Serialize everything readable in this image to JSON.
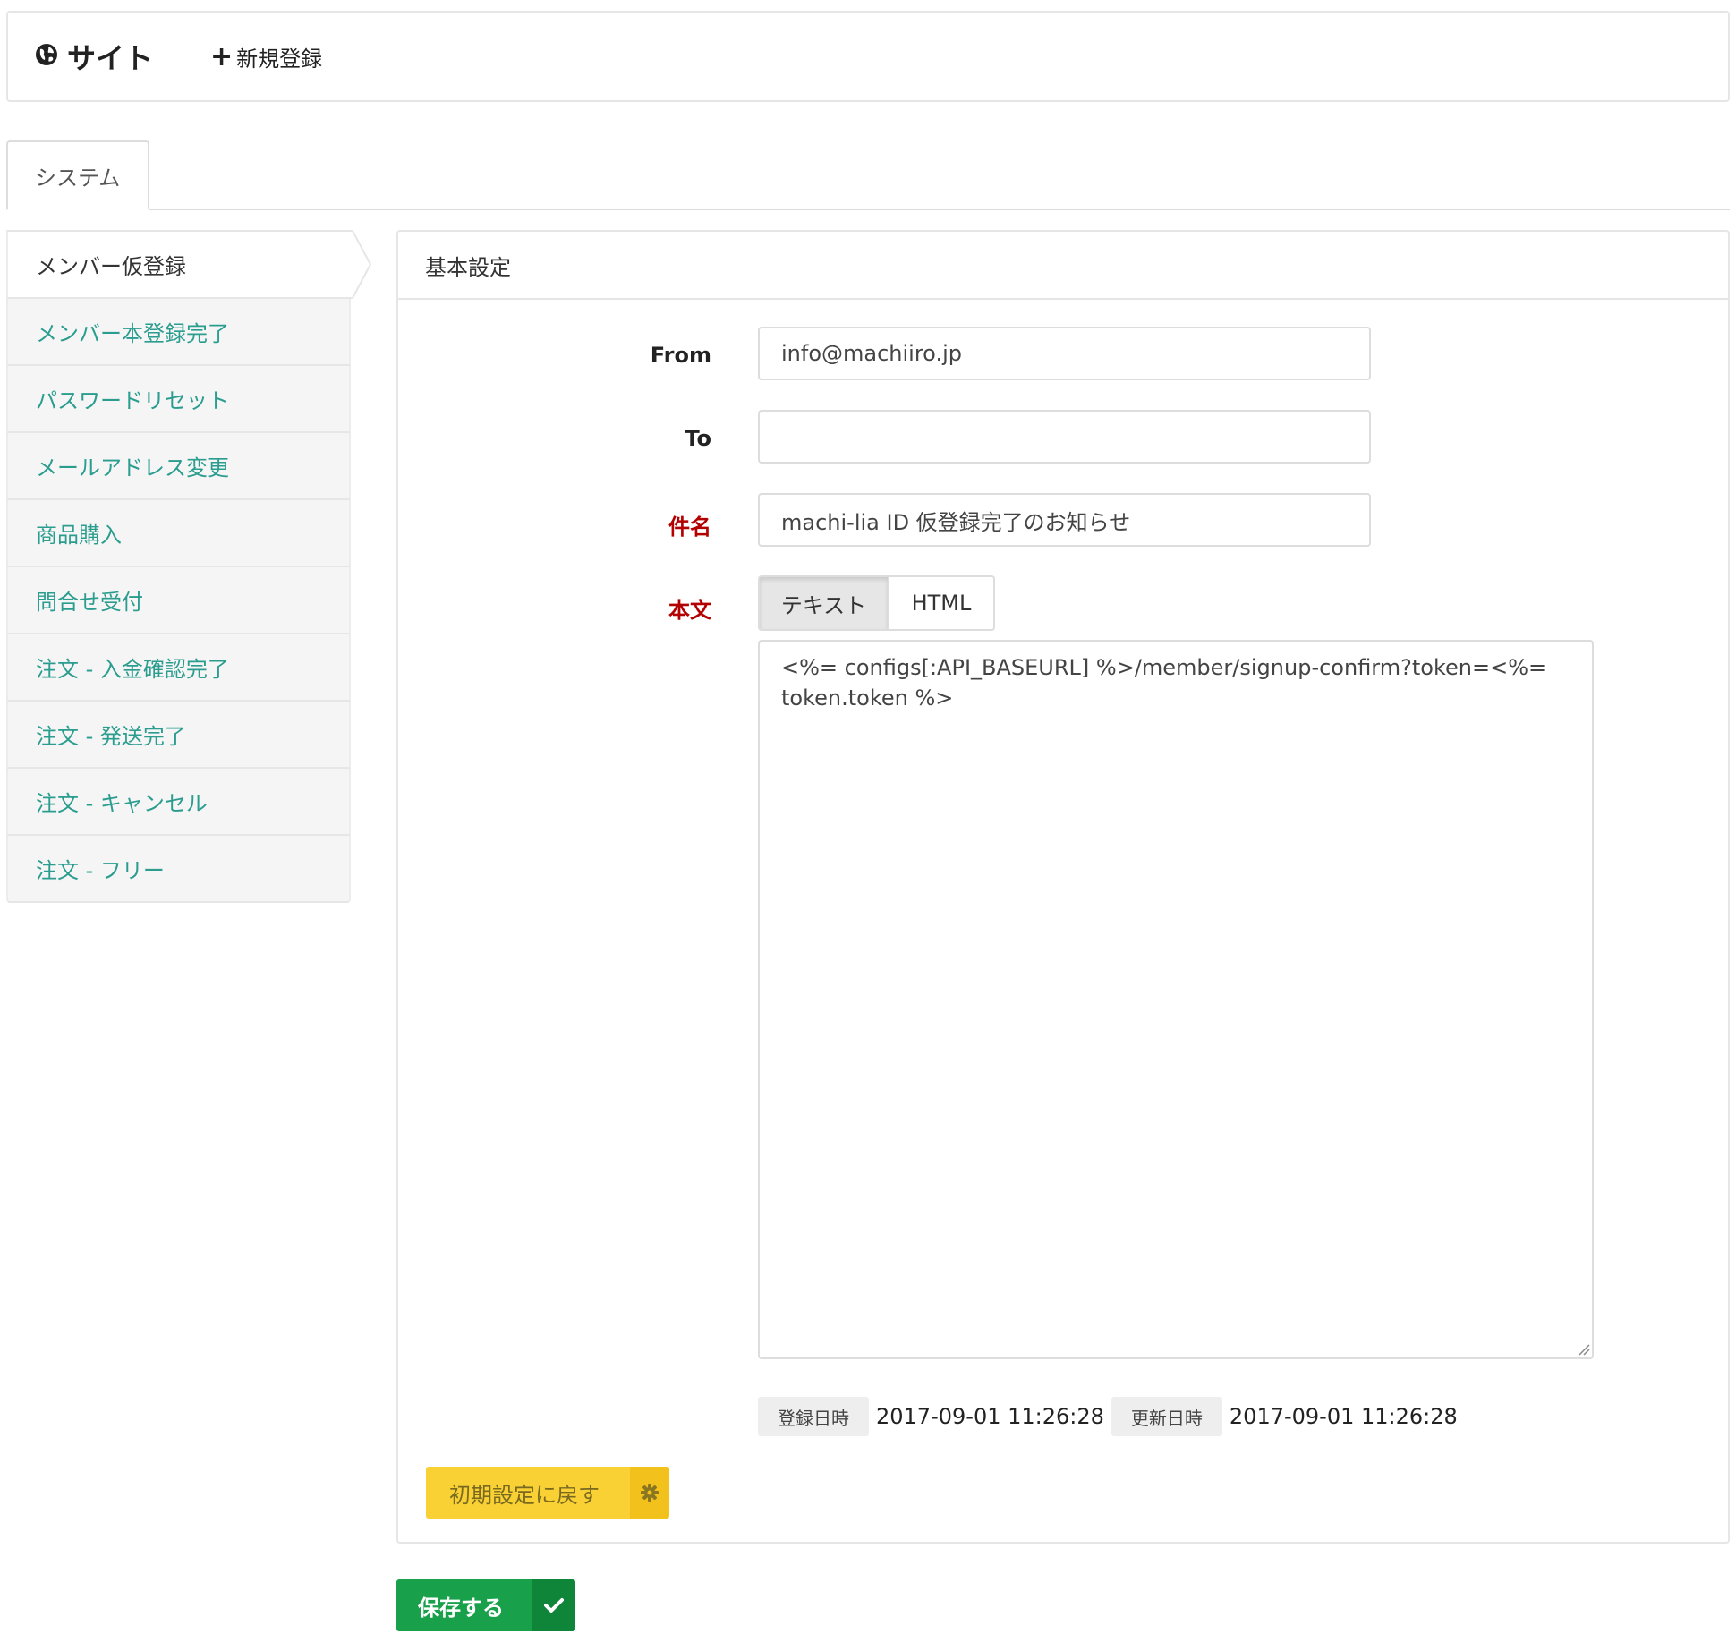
{
  "header": {
    "brand_label": "サイト",
    "brand_icon": "globe-icon",
    "new_label": "新規登録",
    "new_icon": "plus-icon"
  },
  "tabs": {
    "active_label": "システム"
  },
  "sidebar": {
    "items": [
      {
        "label": "メンバー仮登録",
        "active": true
      },
      {
        "label": "メンバー本登録完了"
      },
      {
        "label": "パスワードリセット"
      },
      {
        "label": "メールアドレス変更"
      },
      {
        "label": "商品購入"
      },
      {
        "label": "問合せ受付"
      },
      {
        "label": "注文 - 入金確認完了"
      },
      {
        "label": "注文 - 発送完了"
      },
      {
        "label": "注文 - キャンセル"
      },
      {
        "label": "注文 - フリー"
      }
    ]
  },
  "panel": {
    "heading": "基本設定",
    "from": {
      "label": "From",
      "value": "info@machiiro.jp"
    },
    "to": {
      "label": "To",
      "value": ""
    },
    "subject": {
      "label": "件名",
      "value": "machi-lia ID 仮登録完了のお知らせ",
      "required": true
    },
    "body": {
      "label": "本文",
      "required": true,
      "mode_text": "テキスト",
      "mode_html": "HTML",
      "active_mode": "テキスト",
      "content": "<%= configs[:API_BASEURL] %>/member/signup-confirm?token=<%= token.token %>"
    },
    "meta": {
      "created_label": "登録日時",
      "created_value": "2017-09-01 11:26:28",
      "updated_label": "更新日時",
      "updated_value": "2017-09-01 11:26:28"
    },
    "reset_button": {
      "label": "初期設定に戻す",
      "icon": "gear-icon"
    }
  },
  "save_button": {
    "label": "保存する",
    "icon": "check-icon"
  },
  "colors": {
    "link": "#2a9d8f",
    "required": "#b30000",
    "reset": "#f9d135",
    "save": "#18a04a"
  }
}
